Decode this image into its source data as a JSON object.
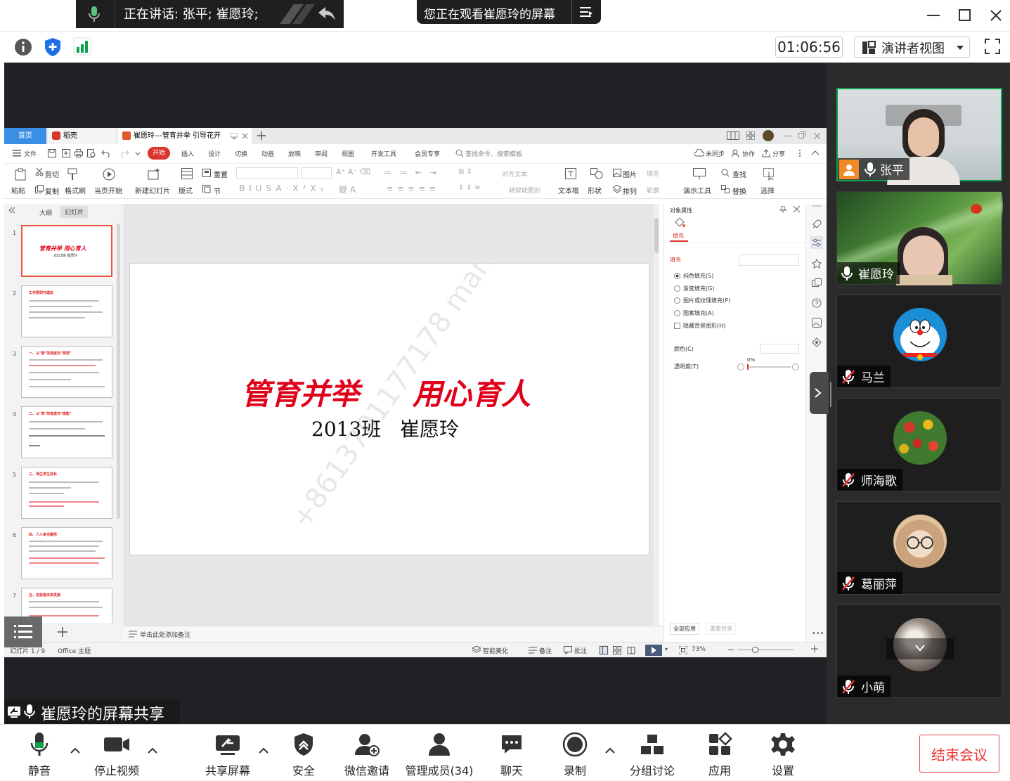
{
  "topbar": {
    "speaking": "正在讲话: 张平; 崔愿玲;",
    "viewing": "您正在观看崔愿玲的屏幕",
    "timer": "01:06:56",
    "view_mode": "演讲者视图"
  },
  "wps": {
    "tabs": [
      {
        "label": "首页"
      },
      {
        "label": "稻壳"
      },
      {
        "label": "崔愿玲---管育并举  引导花开"
      }
    ],
    "menu": [
      "文件",
      "开始",
      "插入",
      "设计",
      "切换",
      "动画",
      "放映",
      "审阅",
      "视图",
      "开发工具",
      "会员专享"
    ],
    "search_placeholder": "查找命令、搜索模板",
    "right_actions": [
      "未同步",
      "协作",
      "分享"
    ],
    "ribbon": {
      "paste": "粘贴",
      "cut": "剪切",
      "copy": "复制",
      "format_painter": "格式刷",
      "play_from_current": "当页开始",
      "new_slide": "新建幻灯片",
      "layout": "版式",
      "section": "节",
      "reset": "重置",
      "textbox": "文本框",
      "shape": "形状",
      "picture": "图片",
      "arrange": "排列",
      "fill": "填充",
      "outline": "轮廓",
      "present_tools": "演示工具",
      "find": "查找",
      "replace": "替换",
      "select": "选择",
      "align_text": "对齐文本",
      "smart_shape": "转智能图形"
    },
    "panel_tabs": [
      "大纲",
      "幻灯片"
    ],
    "slide_numbers": [
      "1",
      "2",
      "3",
      "4",
      "5",
      "6",
      "7"
    ],
    "thumb_titles": [
      "管育并举  用心育人",
      "工作原则与理念",
      "一、从\"管\"的角度去\"规范\"",
      "二、从\"育\"的角度去\"提能\"",
      "三、师生学生成长",
      "四、人人争当模范",
      "五、这就是未来发展"
    ],
    "thumb_sub1": "2013班  崔愿玲",
    "slide": {
      "title_left": "管育并举",
      "title_right": "用心育人",
      "subtitle_class": "2013班",
      "subtitle_name": "崔愿玲",
      "watermark": "+8613701177178 marilyn"
    },
    "notes_placeholder": "单击此处添加备注",
    "status": {
      "slide_count": "幻灯片 1 / 9",
      "theme": "Office 主题",
      "beautify": "智能美化",
      "notes": "备注",
      "comments": "批注",
      "zoom": "73%"
    },
    "props": {
      "header": "对象属性",
      "tab_fill": "填充",
      "section_fill": "填充",
      "options": [
        "纯色填充(S)",
        "渐变填充(G)",
        "图片或纹理填充(P)",
        "图案填充(A)",
        "隐藏背景图形(H)"
      ],
      "color_label": "颜色(C)",
      "transparency_label": "透明度(T)",
      "transparency_value": "0%",
      "apply_all": "全部应用",
      "reset_bg": "重置背景"
    }
  },
  "share_label": "崔愿玲的屏幕共享",
  "participants": [
    {
      "name": "张平"
    },
    {
      "name": "崔愿玲"
    },
    {
      "name": "马兰"
    },
    {
      "name": "师海歌"
    },
    {
      "name": "葛丽萍"
    },
    {
      "name": "小萌"
    }
  ],
  "bottom": {
    "mute": "静音",
    "stop_video": "停止视频",
    "share_screen": "共享屏幕",
    "security": "安全",
    "invite": "微信邀请",
    "members": "管理成员(34)",
    "chat": "聊天",
    "record": "录制",
    "breakout": "分组讨论",
    "apps": "应用",
    "settings": "设置",
    "end_meeting": "结束会议"
  },
  "colors": {
    "accent_green": "#0aa24c",
    "wps_red": "#d9342b",
    "slide_red": "#e1001a",
    "end_red": "#e33333",
    "stage_bg": "#202226"
  }
}
